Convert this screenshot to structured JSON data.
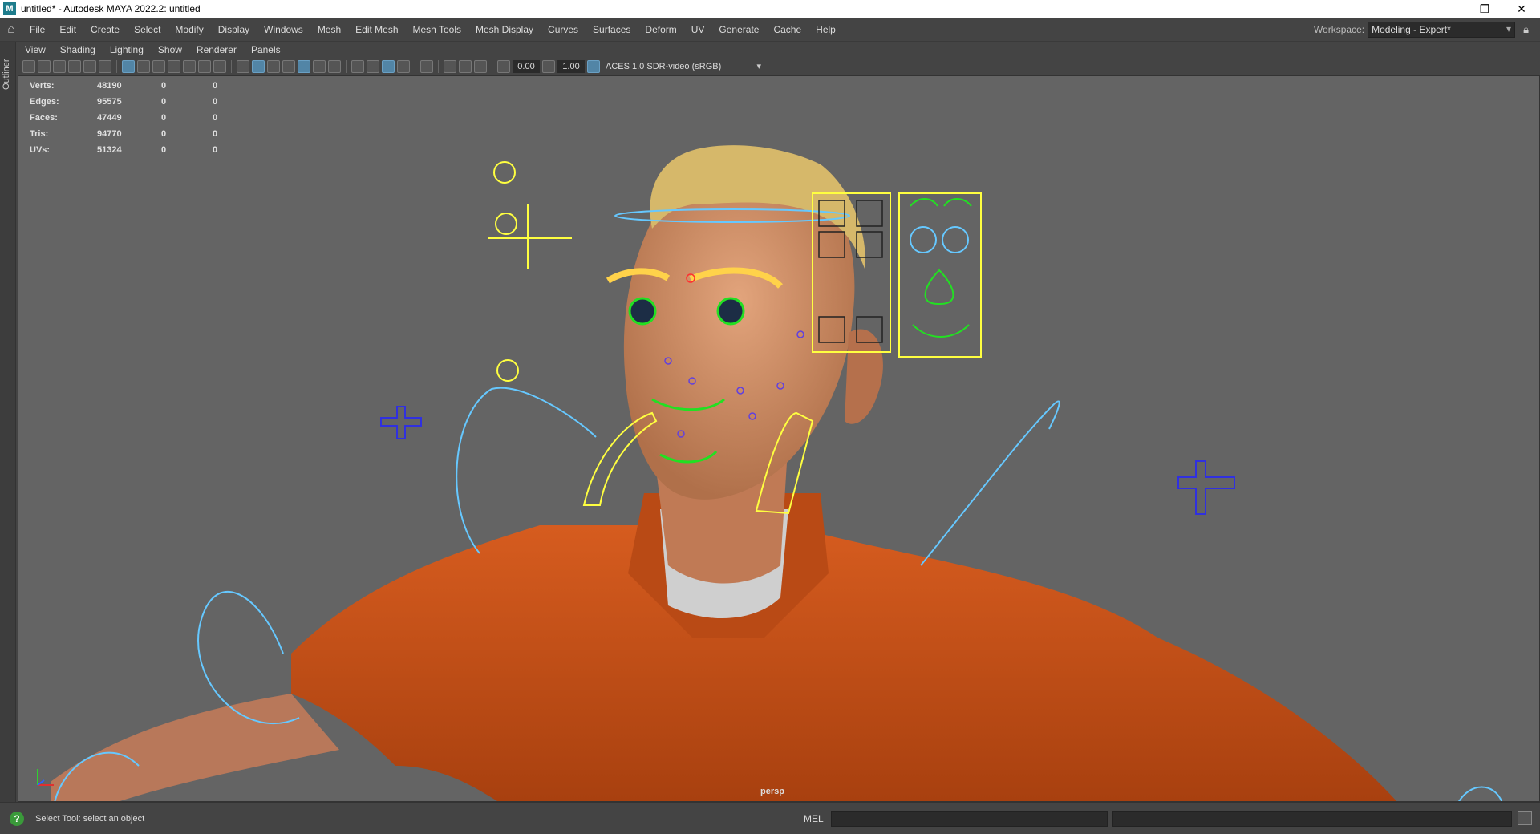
{
  "window": {
    "app_icon": "M",
    "title": "untitled* - Autodesk MAYA 2022.2: untitled",
    "controls": {
      "minimize": "—",
      "maximize": "❐",
      "close": "✕"
    }
  },
  "menubar": {
    "items": [
      "File",
      "Edit",
      "Create",
      "Select",
      "Modify",
      "Display",
      "Windows",
      "Mesh",
      "Edit Mesh",
      "Mesh Tools",
      "Mesh Display",
      "Curves",
      "Surfaces",
      "Deform",
      "UV",
      "Generate",
      "Cache",
      "Help"
    ],
    "workspace_label": "Workspace:",
    "workspace_value": "Modeling - Expert*"
  },
  "left_strip": {
    "outliner_label": "Outliner"
  },
  "panel_menu": {
    "items": [
      "View",
      "Shading",
      "Lighting",
      "Show",
      "Renderer",
      "Panels"
    ]
  },
  "panel_toolbar": {
    "gamma_value": "0.00",
    "exposure_value": "1.00",
    "color_space": "ACES 1.0 SDR-video (sRGB)"
  },
  "hud": {
    "rows": [
      {
        "label": "Verts:",
        "v1": "48190",
        "v2": "0",
        "v3": "0"
      },
      {
        "label": "Edges:",
        "v1": "95575",
        "v2": "0",
        "v3": "0"
      },
      {
        "label": "Faces:",
        "v1": "47449",
        "v2": "0",
        "v3": "0"
      },
      {
        "label": "Tris:",
        "v1": "94770",
        "v2": "0",
        "v3": "0"
      },
      {
        "label": "UVs:",
        "v1": "51324",
        "v2": "0",
        "v3": "0"
      }
    ]
  },
  "viewport": {
    "camera": "persp"
  },
  "statusbar": {
    "message": "Select Tool: select an object",
    "mel_label": "MEL"
  },
  "colors": {
    "viewport_bg": "#646464",
    "shirt": "#c8501a",
    "skin": "#c98a62",
    "hair": "#d6b86a",
    "ctrl_yellow": "#ffff40",
    "ctrl_green": "#22e022",
    "ctrl_cyan": "#66c8ff",
    "ctrl_blue": "#3030e0"
  }
}
